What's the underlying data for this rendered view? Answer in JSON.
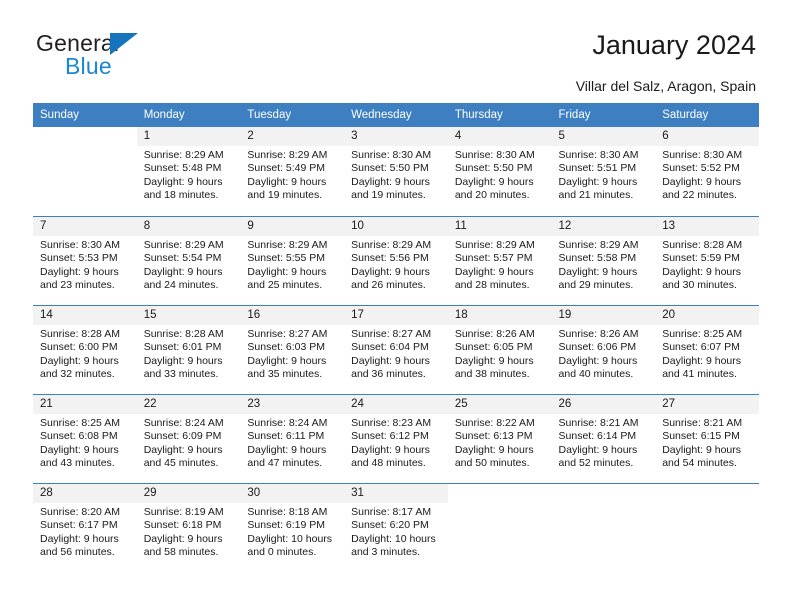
{
  "brand": {
    "name_part1": "General",
    "name_part2": "Blue",
    "triangle_color": "#1574bb",
    "blue_color": "#1b87d2"
  },
  "header": {
    "title": "January 2024",
    "subtitle": "Villar del Salz, Aragon, Spain"
  },
  "theme": {
    "header_row_color": "#3d7fc1",
    "daynum_band_color": "#f2f2f2",
    "text_color": "#1a1a1a"
  },
  "weekdays": [
    "Sunday",
    "Monday",
    "Tuesday",
    "Wednesday",
    "Thursday",
    "Friday",
    "Saturday"
  ],
  "weeks": [
    [
      {
        "day": "",
        "blank": true,
        "sunrise": "",
        "sunset": "",
        "daylight_line1": "",
        "daylight_line2": ""
      },
      {
        "day": "1",
        "sunrise": "Sunrise: 8:29 AM",
        "sunset": "Sunset: 5:48 PM",
        "daylight_line1": "Daylight: 9 hours",
        "daylight_line2": "and 18 minutes."
      },
      {
        "day": "2",
        "sunrise": "Sunrise: 8:29 AM",
        "sunset": "Sunset: 5:49 PM",
        "daylight_line1": "Daylight: 9 hours",
        "daylight_line2": "and 19 minutes."
      },
      {
        "day": "3",
        "sunrise": "Sunrise: 8:30 AM",
        "sunset": "Sunset: 5:50 PM",
        "daylight_line1": "Daylight: 9 hours",
        "daylight_line2": "and 19 minutes."
      },
      {
        "day": "4",
        "sunrise": "Sunrise: 8:30 AM",
        "sunset": "Sunset: 5:50 PM",
        "daylight_line1": "Daylight: 9 hours",
        "daylight_line2": "and 20 minutes."
      },
      {
        "day": "5",
        "sunrise": "Sunrise: 8:30 AM",
        "sunset": "Sunset: 5:51 PM",
        "daylight_line1": "Daylight: 9 hours",
        "daylight_line2": "and 21 minutes."
      },
      {
        "day": "6",
        "sunrise": "Sunrise: 8:30 AM",
        "sunset": "Sunset: 5:52 PM",
        "daylight_line1": "Daylight: 9 hours",
        "daylight_line2": "and 22 minutes."
      }
    ],
    [
      {
        "day": "7",
        "sunrise": "Sunrise: 8:30 AM",
        "sunset": "Sunset: 5:53 PM",
        "daylight_line1": "Daylight: 9 hours",
        "daylight_line2": "and 23 minutes."
      },
      {
        "day": "8",
        "sunrise": "Sunrise: 8:29 AM",
        "sunset": "Sunset: 5:54 PM",
        "daylight_line1": "Daylight: 9 hours",
        "daylight_line2": "and 24 minutes."
      },
      {
        "day": "9",
        "sunrise": "Sunrise: 8:29 AM",
        "sunset": "Sunset: 5:55 PM",
        "daylight_line1": "Daylight: 9 hours",
        "daylight_line2": "and 25 minutes."
      },
      {
        "day": "10",
        "sunrise": "Sunrise: 8:29 AM",
        "sunset": "Sunset: 5:56 PM",
        "daylight_line1": "Daylight: 9 hours",
        "daylight_line2": "and 26 minutes."
      },
      {
        "day": "11",
        "sunrise": "Sunrise: 8:29 AM",
        "sunset": "Sunset: 5:57 PM",
        "daylight_line1": "Daylight: 9 hours",
        "daylight_line2": "and 28 minutes."
      },
      {
        "day": "12",
        "sunrise": "Sunrise: 8:29 AM",
        "sunset": "Sunset: 5:58 PM",
        "daylight_line1": "Daylight: 9 hours",
        "daylight_line2": "and 29 minutes."
      },
      {
        "day": "13",
        "sunrise": "Sunrise: 8:28 AM",
        "sunset": "Sunset: 5:59 PM",
        "daylight_line1": "Daylight: 9 hours",
        "daylight_line2": "and 30 minutes."
      }
    ],
    [
      {
        "day": "14",
        "sunrise": "Sunrise: 8:28 AM",
        "sunset": "Sunset: 6:00 PM",
        "daylight_line1": "Daylight: 9 hours",
        "daylight_line2": "and 32 minutes."
      },
      {
        "day": "15",
        "sunrise": "Sunrise: 8:28 AM",
        "sunset": "Sunset: 6:01 PM",
        "daylight_line1": "Daylight: 9 hours",
        "daylight_line2": "and 33 minutes."
      },
      {
        "day": "16",
        "sunrise": "Sunrise: 8:27 AM",
        "sunset": "Sunset: 6:03 PM",
        "daylight_line1": "Daylight: 9 hours",
        "daylight_line2": "and 35 minutes."
      },
      {
        "day": "17",
        "sunrise": "Sunrise: 8:27 AM",
        "sunset": "Sunset: 6:04 PM",
        "daylight_line1": "Daylight: 9 hours",
        "daylight_line2": "and 36 minutes."
      },
      {
        "day": "18",
        "sunrise": "Sunrise: 8:26 AM",
        "sunset": "Sunset: 6:05 PM",
        "daylight_line1": "Daylight: 9 hours",
        "daylight_line2": "and 38 minutes."
      },
      {
        "day": "19",
        "sunrise": "Sunrise: 8:26 AM",
        "sunset": "Sunset: 6:06 PM",
        "daylight_line1": "Daylight: 9 hours",
        "daylight_line2": "and 40 minutes."
      },
      {
        "day": "20",
        "sunrise": "Sunrise: 8:25 AM",
        "sunset": "Sunset: 6:07 PM",
        "daylight_line1": "Daylight: 9 hours",
        "daylight_line2": "and 41 minutes."
      }
    ],
    [
      {
        "day": "21",
        "sunrise": "Sunrise: 8:25 AM",
        "sunset": "Sunset: 6:08 PM",
        "daylight_line1": "Daylight: 9 hours",
        "daylight_line2": "and 43 minutes."
      },
      {
        "day": "22",
        "sunrise": "Sunrise: 8:24 AM",
        "sunset": "Sunset: 6:09 PM",
        "daylight_line1": "Daylight: 9 hours",
        "daylight_line2": "and 45 minutes."
      },
      {
        "day": "23",
        "sunrise": "Sunrise: 8:24 AM",
        "sunset": "Sunset: 6:11 PM",
        "daylight_line1": "Daylight: 9 hours",
        "daylight_line2": "and 47 minutes."
      },
      {
        "day": "24",
        "sunrise": "Sunrise: 8:23 AM",
        "sunset": "Sunset: 6:12 PM",
        "daylight_line1": "Daylight: 9 hours",
        "daylight_line2": "and 48 minutes."
      },
      {
        "day": "25",
        "sunrise": "Sunrise: 8:22 AM",
        "sunset": "Sunset: 6:13 PM",
        "daylight_line1": "Daylight: 9 hours",
        "daylight_line2": "and 50 minutes."
      },
      {
        "day": "26",
        "sunrise": "Sunrise: 8:21 AM",
        "sunset": "Sunset: 6:14 PM",
        "daylight_line1": "Daylight: 9 hours",
        "daylight_line2": "and 52 minutes."
      },
      {
        "day": "27",
        "sunrise": "Sunrise: 8:21 AM",
        "sunset": "Sunset: 6:15 PM",
        "daylight_line1": "Daylight: 9 hours",
        "daylight_line2": "and 54 minutes."
      }
    ],
    [
      {
        "day": "28",
        "sunrise": "Sunrise: 8:20 AM",
        "sunset": "Sunset: 6:17 PM",
        "daylight_line1": "Daylight: 9 hours",
        "daylight_line2": "and 56 minutes."
      },
      {
        "day": "29",
        "sunrise": "Sunrise: 8:19 AM",
        "sunset": "Sunset: 6:18 PM",
        "daylight_line1": "Daylight: 9 hours",
        "daylight_line2": "and 58 minutes."
      },
      {
        "day": "30",
        "sunrise": "Sunrise: 8:18 AM",
        "sunset": "Sunset: 6:19 PM",
        "daylight_line1": "Daylight: 10 hours",
        "daylight_line2": "and 0 minutes."
      },
      {
        "day": "31",
        "sunrise": "Sunrise: 8:17 AM",
        "sunset": "Sunset: 6:20 PM",
        "daylight_line1": "Daylight: 10 hours",
        "daylight_line2": "and 3 minutes."
      },
      {
        "day": "",
        "blank": true,
        "sunrise": "",
        "sunset": "",
        "daylight_line1": "",
        "daylight_line2": ""
      },
      {
        "day": "",
        "blank": true,
        "sunrise": "",
        "sunset": "",
        "daylight_line1": "",
        "daylight_line2": ""
      },
      {
        "day": "",
        "blank": true,
        "sunrise": "",
        "sunset": "",
        "daylight_line1": "",
        "daylight_line2": ""
      }
    ]
  ]
}
